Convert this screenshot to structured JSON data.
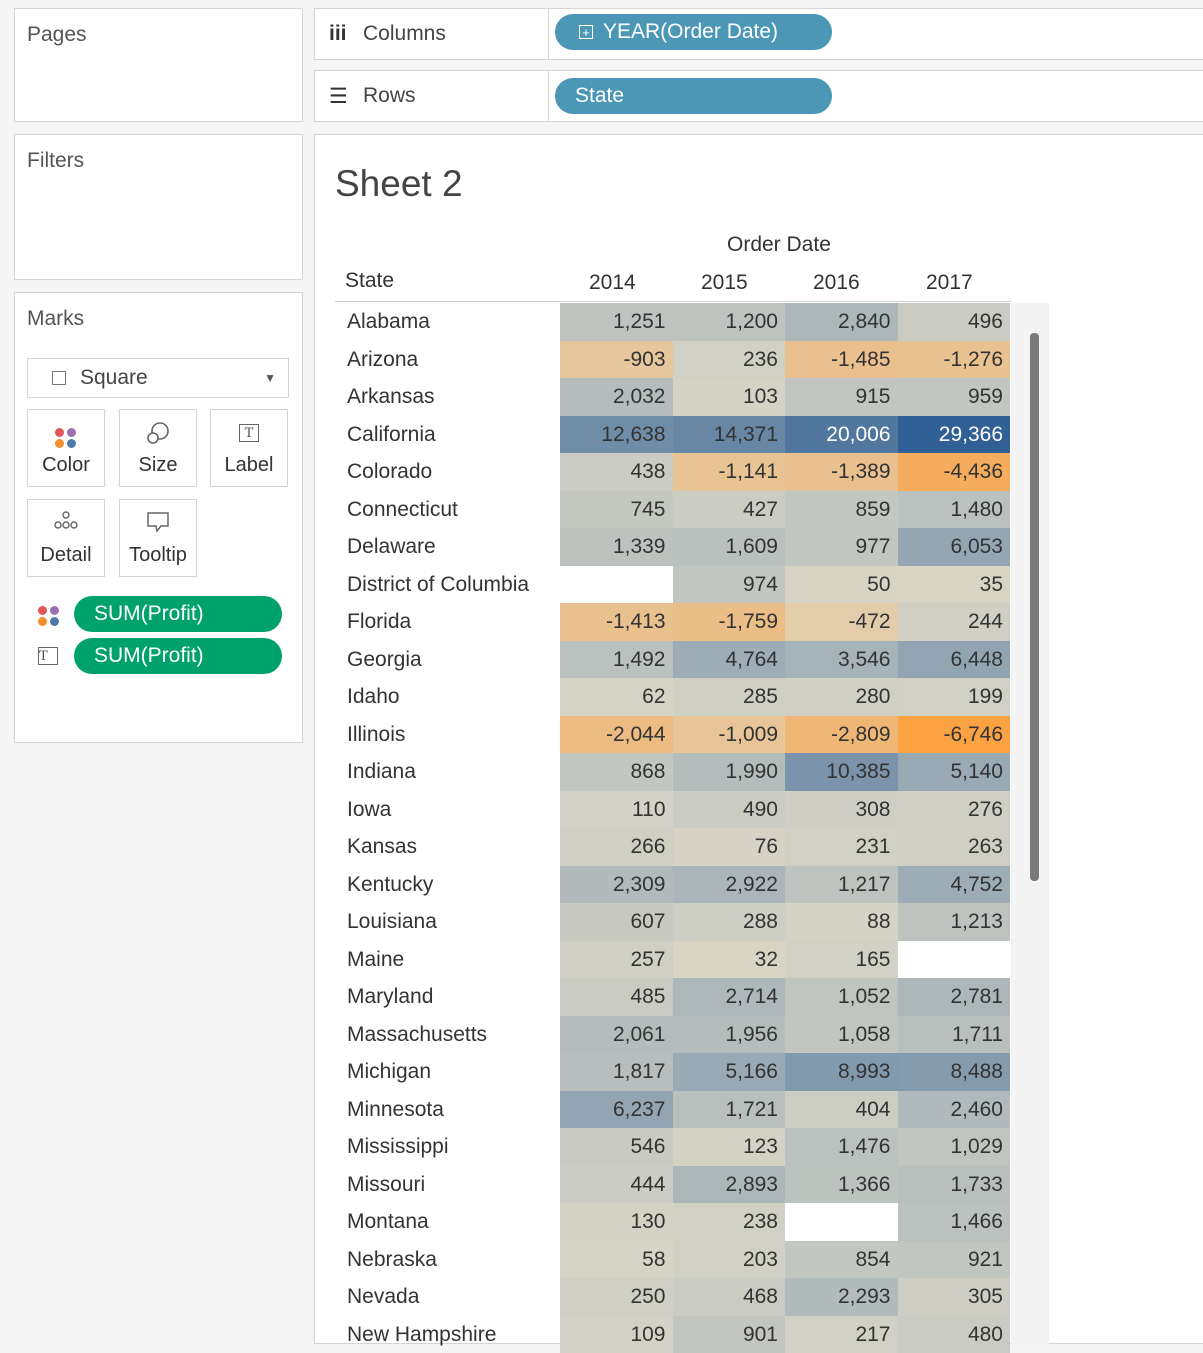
{
  "pages": {
    "title": "Pages"
  },
  "filters": {
    "title": "Filters"
  },
  "shelves": {
    "columns_label": "Columns",
    "columns_pill": "YEAR(Order Date)",
    "rows_label": "Rows",
    "rows_pill": "State"
  },
  "marks": {
    "title": "Marks",
    "mark_type": "Square",
    "buttons": {
      "color": "Color",
      "size": "Size",
      "label": "Label",
      "detail": "Detail",
      "tooltip": "Tooltip"
    },
    "fields": [
      {
        "role": "color",
        "icon": "color-icon",
        "name": "SUM(Profit)"
      },
      {
        "role": "label",
        "icon": "label-icon",
        "name": "SUM(Profit)"
      }
    ]
  },
  "view": {
    "sheet_title": "Sheet 2",
    "column_group_header": "Order Date",
    "row_header": "State",
    "years": [
      "2014",
      "2015",
      "2016",
      "2017"
    ]
  },
  "colors": {
    "pill_blue": "#4b97b5",
    "pill_green": "#00a26b",
    "diverging_negative": "#fca13f",
    "diverging_neutral": "#dcd8c8",
    "diverging_positive": "#2e5f94"
  },
  "table": [
    {
      "state": "Alabama",
      "values": [
        "1,251",
        "1,200",
        "2,840",
        "496"
      ]
    },
    {
      "state": "Arizona",
      "values": [
        "-903",
        "236",
        "-1,485",
        "-1,276"
      ]
    },
    {
      "state": "Arkansas",
      "values": [
        "2,032",
        "103",
        "915",
        "959"
      ]
    },
    {
      "state": "California",
      "values": [
        "12,638",
        "14,371",
        "20,006",
        "29,366"
      ]
    },
    {
      "state": "Colorado",
      "values": [
        "438",
        "-1,141",
        "-1,389",
        "-4,436"
      ]
    },
    {
      "state": "Connecticut",
      "values": [
        "745",
        "427",
        "859",
        "1,480"
      ]
    },
    {
      "state": "Delaware",
      "values": [
        "1,339",
        "1,609",
        "977",
        "6,053"
      ]
    },
    {
      "state": "District of Columbia",
      "values": [
        "",
        "974",
        "50",
        "35"
      ]
    },
    {
      "state": "Florida",
      "values": [
        "-1,413",
        "-1,759",
        "-472",
        "244"
      ]
    },
    {
      "state": "Georgia",
      "values": [
        "1,492",
        "4,764",
        "3,546",
        "6,448"
      ]
    },
    {
      "state": "Idaho",
      "values": [
        "62",
        "285",
        "280",
        "199"
      ]
    },
    {
      "state": "Illinois",
      "values": [
        "-2,044",
        "-1,009",
        "-2,809",
        "-6,746"
      ]
    },
    {
      "state": "Indiana",
      "values": [
        "868",
        "1,990",
        "10,385",
        "5,140"
      ]
    },
    {
      "state": "Iowa",
      "values": [
        "110",
        "490",
        "308",
        "276"
      ]
    },
    {
      "state": "Kansas",
      "values": [
        "266",
        "76",
        "231",
        "263"
      ]
    },
    {
      "state": "Kentucky",
      "values": [
        "2,309",
        "2,922",
        "1,217",
        "4,752"
      ]
    },
    {
      "state": "Louisiana",
      "values": [
        "607",
        "288",
        "88",
        "1,213"
      ]
    },
    {
      "state": "Maine",
      "values": [
        "257",
        "32",
        "165",
        ""
      ]
    },
    {
      "state": "Maryland",
      "values": [
        "485",
        "2,714",
        "1,052",
        "2,781"
      ]
    },
    {
      "state": "Massachusetts",
      "values": [
        "2,061",
        "1,956",
        "1,058",
        "1,711"
      ]
    },
    {
      "state": "Michigan",
      "values": [
        "1,817",
        "5,166",
        "8,993",
        "8,488"
      ]
    },
    {
      "state": "Minnesota",
      "values": [
        "6,237",
        "1,721",
        "404",
        "2,460"
      ]
    },
    {
      "state": "Mississippi",
      "values": [
        "546",
        "123",
        "1,476",
        "1,029"
      ]
    },
    {
      "state": "Missouri",
      "values": [
        "444",
        "2,893",
        "1,366",
        "1,733"
      ]
    },
    {
      "state": "Montana",
      "values": [
        "130",
        "238",
        "",
        "1,466"
      ]
    },
    {
      "state": "Nebraska",
      "values": [
        "58",
        "203",
        "854",
        "921"
      ]
    },
    {
      "state": "Nevada",
      "values": [
        "250",
        "468",
        "2,293",
        "305"
      ]
    },
    {
      "state": "New Hampshire",
      "values": [
        "109",
        "901",
        "217",
        "480"
      ]
    }
  ]
}
